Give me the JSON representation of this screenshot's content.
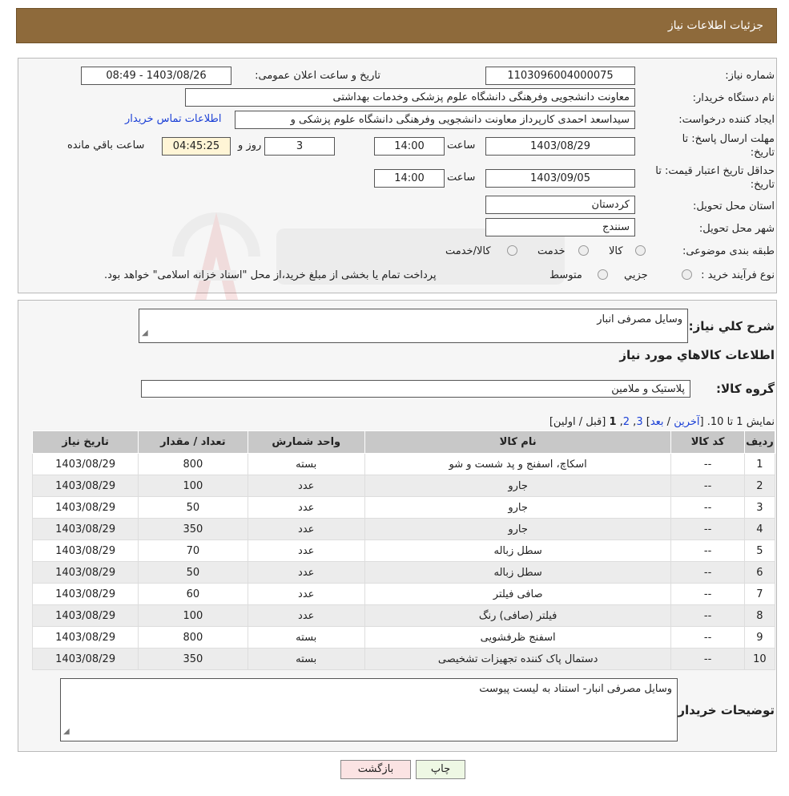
{
  "header": {
    "title": "جزئیات اطلاعات نیاز"
  },
  "form": {
    "need_number_label": "شماره نیاز:",
    "need_number": "1103096004000075",
    "announce_label": "تاریخ و ساعت اعلان عمومی:",
    "announce_value": "1403/08/26 - 08:49",
    "buyer_org_label": "نام دستگاه خریدار:",
    "buyer_org": "معاونت دانشجویی وفرهنگی دانشگاه علوم پزشکی وخدمات بهداشتی",
    "creator_label": "ایجاد کننده درخواست:",
    "creator": "سیداسعد احمدی کارپرداز معاونت دانشجویی وفرهنگی دانشگاه علوم پزشکی و",
    "contact_link": "اطلاعات تماس خریدار",
    "deadline_label_1": "مهلت ارسال پاسخ: تا",
    "deadline_label_2": "تاریخ:",
    "deadline_date": "1403/08/29",
    "time_label": "ساعت",
    "deadline_time": "14:00",
    "days_value": "3",
    "days_label": "روز و",
    "remaining_time": "04:45:25",
    "remaining_label": "ساعت باقي مانده",
    "validity_label_1": "حداقل تاریخ اعتبار قیمت: تا",
    "validity_label_2": "تاریخ:",
    "validity_date": "1403/09/05",
    "validity_time": "14:00",
    "province_label": "استان محل تحویل:",
    "province": "کردستان",
    "city_label": "شهر محل تحویل:",
    "city": "سنندج",
    "category_label": "طبقه بندی موضوعی:",
    "category_options": [
      "کالا",
      "خدمت",
      "کالا/خدمت"
    ],
    "process_label": "نوع فرآیند خرید :",
    "process_options": [
      "جزیي",
      "متوسط"
    ],
    "payment_note": "پرداخت تمام یا بخشی از مبلغ خرید،از محل \"اسناد خزانه اسلامی\" خواهد بود."
  },
  "details": {
    "summary_label": "شرح کلي نياز:",
    "summary_value": "وسایل مصرفی انبار",
    "goods_info_title": "اطلاعات کالاهاي مورد نياز",
    "group_label": "گروه کالا:",
    "group_value": "پلاستیک و ملامین",
    "pagination": {
      "prefix": "نمايش 1 تا 10.",
      "open_bracket": "[",
      "last": "آخرین",
      "sep": "/",
      "next": "بعد",
      "close_bracket": "]",
      "page3": "3",
      "page2": "2",
      "current": "1",
      "prev_first": "[قبل / اولین]"
    },
    "table": {
      "headers": [
        "رديف",
        "کد کالا",
        "نام کالا",
        "واحد شمارش",
        "تعداد / مقدار",
        "تاریخ نیاز"
      ],
      "rows": [
        [
          "1",
          "--",
          "اسکاچ، اسفنج و پد شست و شو",
          "بسته",
          "800",
          "1403/08/29"
        ],
        [
          "2",
          "--",
          "جارو",
          "عدد",
          "100",
          "1403/08/29"
        ],
        [
          "3",
          "--",
          "جارو",
          "عدد",
          "50",
          "1403/08/29"
        ],
        [
          "4",
          "--",
          "جارو",
          "عدد",
          "350",
          "1403/08/29"
        ],
        [
          "5",
          "--",
          "سطل زباله",
          "عدد",
          "70",
          "1403/08/29"
        ],
        [
          "6",
          "--",
          "سطل زباله",
          "عدد",
          "50",
          "1403/08/29"
        ],
        [
          "7",
          "--",
          "صافی فیلتر",
          "عدد",
          "60",
          "1403/08/29"
        ],
        [
          "8",
          "--",
          "فیلتر (صافی) رنگ",
          "عدد",
          "100",
          "1403/08/29"
        ],
        [
          "9",
          "--",
          "اسفنج ظرفشویی",
          "بسته",
          "800",
          "1403/08/29"
        ],
        [
          "10",
          "--",
          "دستمال پاک کننده تجهیزات تشخیصی",
          "بسته",
          "350",
          "1403/08/29"
        ]
      ]
    },
    "buyer_notes_label": "توضیحات خریدار:",
    "buyer_notes_value": "وسایل مصرفی انبار- استناد به لیست پیوست"
  },
  "buttons": {
    "print": "چاپ",
    "back": "بازگشت"
  },
  "colors": {
    "header_bg": "#8e6a3b",
    "link": "#1a3fd6",
    "print_bg": "#eef8e4",
    "back_bg": "#fbe3e3"
  }
}
